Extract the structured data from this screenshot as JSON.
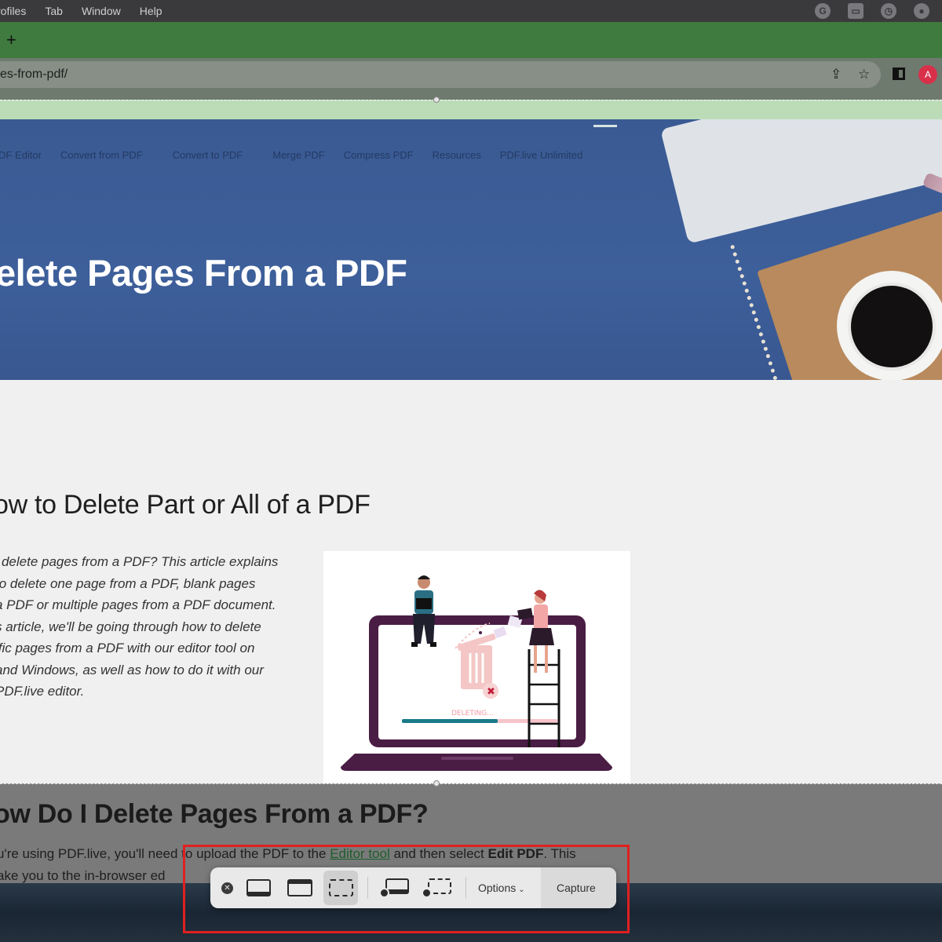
{
  "menubar": {
    "items": [
      "rofiles",
      "Tab",
      "Window",
      "Help"
    ],
    "status_icons": [
      "grammarly-icon",
      "screen-share-icon",
      "time-machine-icon",
      "user-icon"
    ]
  },
  "tabstrip": {
    "new_tab": "+"
  },
  "toolbar": {
    "url": "es-from-pdf/",
    "share_icon": "⇪",
    "bookmark_icon": "☆",
    "profile_initial": "A"
  },
  "hero": {
    "nav": [
      "DF Editor",
      "Convert from PDF",
      "Convert to PDF",
      "Merge PDF",
      "Compress PDF",
      "Resources",
      "PDF.live Unlimited"
    ],
    "title": "elete Pages From a PDF"
  },
  "article": {
    "heading": "ow to Delete Part or All of a PDF",
    "intro_lines": [
      "' delete pages from a PDF? This article explains",
      " to delete one page from a PDF, blank pages",
      " a PDF or multiple pages from a PDF document.",
      "s article, we'll be going through how to delete",
      "ific pages from a PDF with our editor tool on",
      "and Windows, as well as how to do it with our",
      "PDF.live editor."
    ],
    "illustration_label": "DELETING..."
  },
  "section2": {
    "heading": "ow Do I Delete Pages From a PDF?",
    "line1_a": "u're using PDF.live, you'll need to upload the PDF to the ",
    "line1_link": "Editor tool",
    "line1_b": " and then select ",
    "line1_bold": "Edit PDF",
    "line1_c": ". This",
    "line2": "ake you to the in-browser ed"
  },
  "screenshot_toolbar": {
    "options_label": "Options",
    "capture_label": "Capture",
    "selected_mode": "capture-selected-portion"
  },
  "colors": {
    "tab_green": "#3f7a3f",
    "hero_blue": "#3d5f9a",
    "highlight_red": "#e02020",
    "illustration_purple": "#4a1d44",
    "progress_teal": "#1a7a8a"
  }
}
